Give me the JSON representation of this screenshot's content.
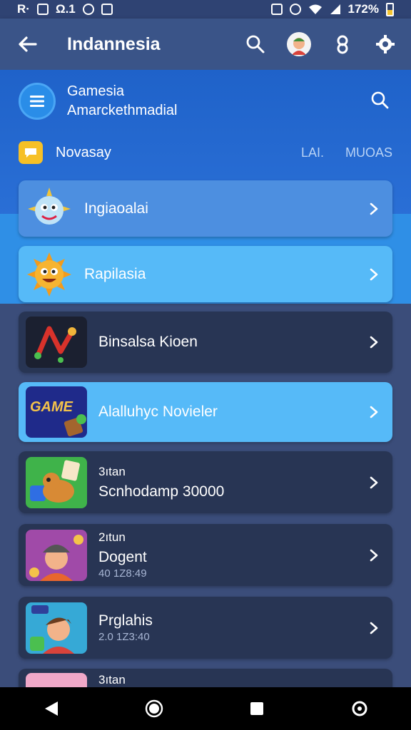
{
  "status_bar": {
    "left_text": "R·",
    "carrier_text": "Ω.1",
    "battery_text": "172%"
  },
  "app_bar": {
    "title": "Indannesia",
    "icons": [
      "back-arrow-icon",
      "search-icon",
      "avatar",
      "profile-icon",
      "gear-icon"
    ]
  },
  "header": {
    "game_name": "Gamesia",
    "game_sub": "Amarckethmadial",
    "novasay_label": "Novasay",
    "tabs": [
      "LAI.",
      "MUOAS"
    ]
  },
  "list": {
    "items": [
      {
        "title": "Ingiaoalai",
        "style": "blue"
      },
      {
        "title": "Rapilasia",
        "style": "light"
      },
      {
        "title": "Binsalsa Kioen",
        "style": "dark"
      },
      {
        "title": "Alalluhyc Novieler",
        "style": "light",
        "thumb_text": "GAME"
      },
      {
        "pre": "3ıtan",
        "title": "Scnhodamp 30000",
        "style": "dark"
      },
      {
        "pre": "2ıtun",
        "title": "Dogent",
        "meta": "40 1Z8:49",
        "style": "dark"
      },
      {
        "title": "Prglahis",
        "meta": "2.0 1Z3:40",
        "style": "dark"
      },
      {
        "pre": "3ıtan",
        "style": "dark"
      }
    ]
  },
  "colors": {
    "app_bar": "#3a5488",
    "header": "#1f62c9",
    "card_dark": "#283554",
    "card_light": "#56baf8",
    "card_blue": "#4d8fe0"
  }
}
